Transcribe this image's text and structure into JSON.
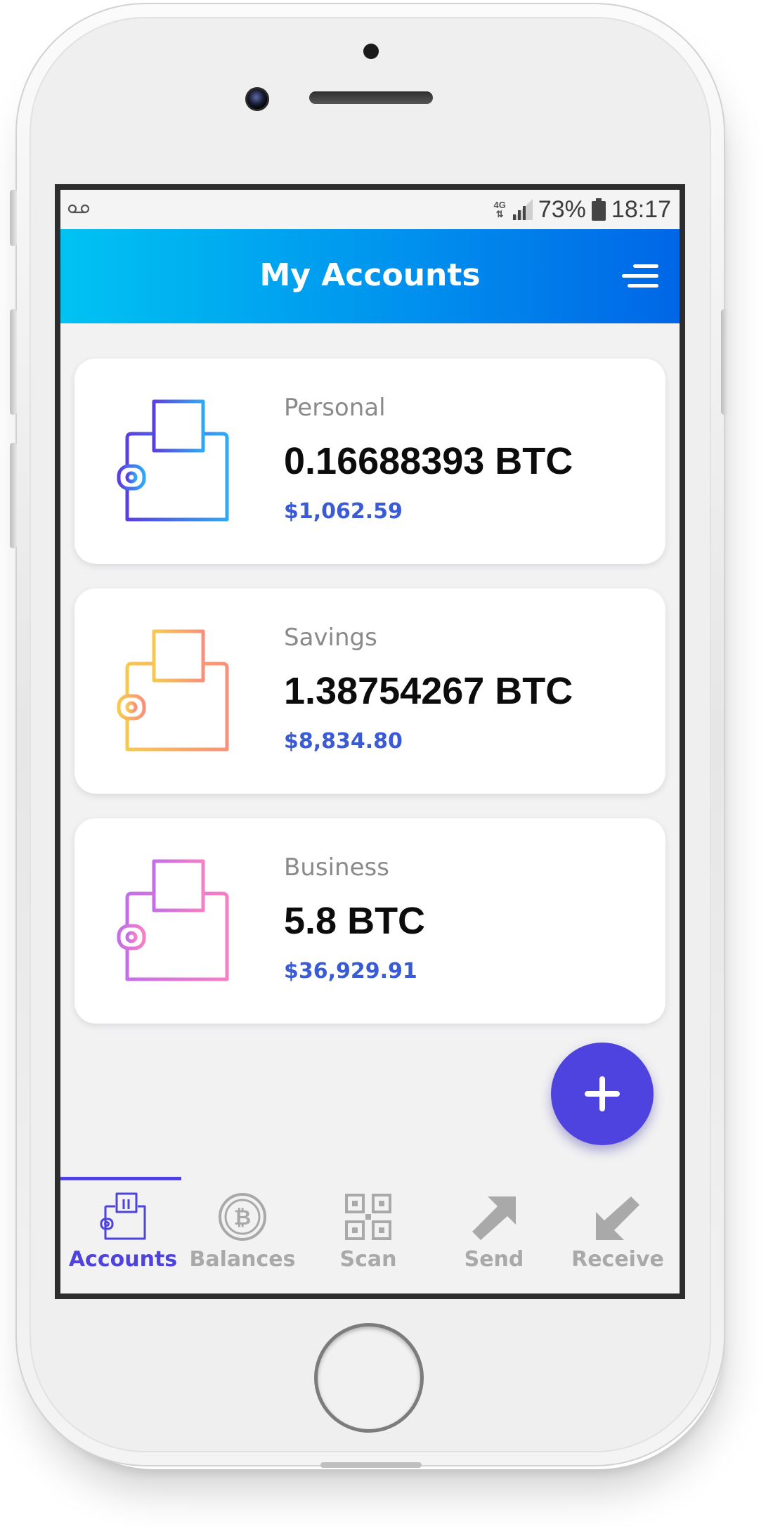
{
  "status_bar": {
    "network": "4G",
    "battery": "73%",
    "time": "18:17"
  },
  "app_bar": {
    "title": "My Accounts"
  },
  "accounts": [
    {
      "name": "Personal",
      "btc": "0.16688393 BTC",
      "usd": "$1,062.59",
      "icon": "wallet-icon",
      "gradient": [
        "#5b3fe0",
        "#2fa9f5"
      ]
    },
    {
      "name": "Savings",
      "btc": "1.38754267 BTC",
      "usd": "$8,834.80",
      "icon": "wallet-icon",
      "gradient": [
        "#f7c94e",
        "#fb8f7a"
      ]
    },
    {
      "name": "Business",
      "btc": "5.8 BTC",
      "usd": "$36,929.91",
      "icon": "wallet-icon",
      "gradient": [
        "#c46ee8",
        "#f77fc4"
      ]
    }
  ],
  "fab": {
    "icon": "plus-icon",
    "color": "#4f43e0"
  },
  "bottom_nav": {
    "active": "Accounts",
    "items": [
      {
        "label": "Accounts",
        "icon": "wallet-icon"
      },
      {
        "label": "Balances",
        "icon": "bitcoin-coin-icon"
      },
      {
        "label": "Scan",
        "icon": "qr-code-icon"
      },
      {
        "label": "Send",
        "icon": "arrow-up-right-icon"
      },
      {
        "label": "Receive",
        "icon": "arrow-down-left-icon"
      }
    ]
  },
  "colors": {
    "accent": "#4f43e0",
    "header_gradient": [
      "#00c3f2",
      "#0066e6"
    ],
    "usd_text": "#3b5bd6",
    "nav_inactive": "#a9a9a9"
  }
}
